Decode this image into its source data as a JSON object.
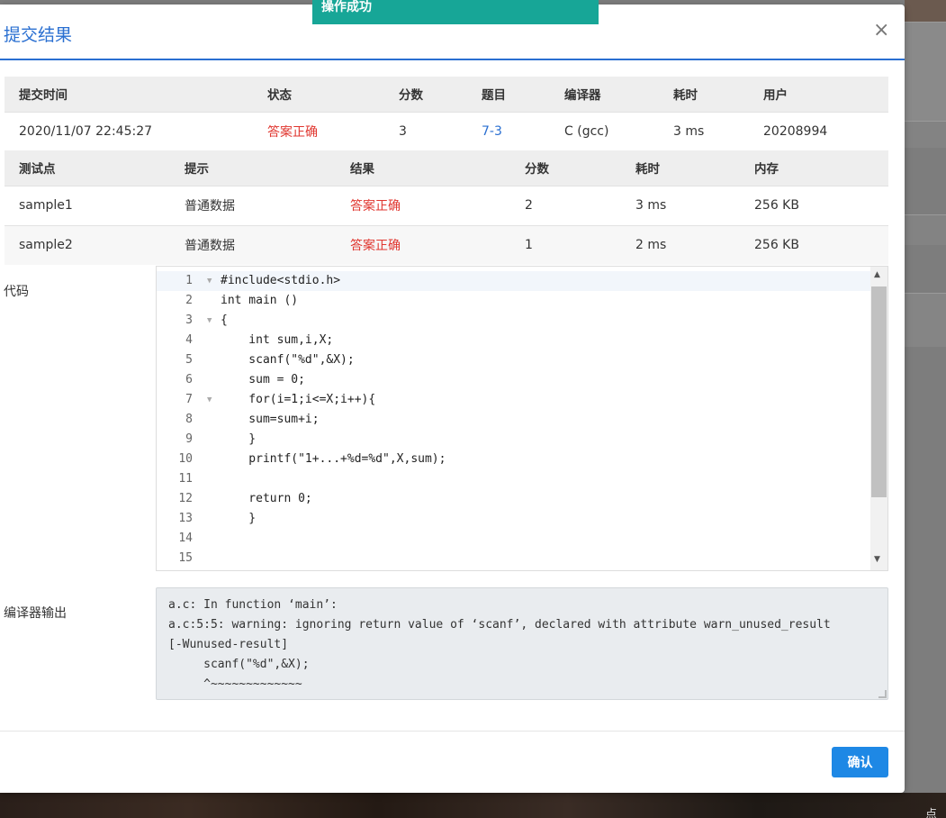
{
  "toast": {
    "text": "操作成功"
  },
  "modal": {
    "title": "提交结果",
    "close_glyph": "×"
  },
  "submission_table": {
    "headers": [
      "提交时间",
      "状态",
      "分数",
      "题目",
      "编译器",
      "耗时",
      "用户"
    ],
    "row": {
      "time": "2020/11/07 22:45:27",
      "status": "答案正确",
      "score": "3",
      "problem": "7-3",
      "compiler": "C (gcc)",
      "elapsed": "3 ms",
      "user": "20208994"
    }
  },
  "testcase_table": {
    "headers": [
      "测试点",
      "提示",
      "结果",
      "分数",
      "耗时",
      "内存"
    ],
    "rows": [
      {
        "case": "sample1",
        "hint": "普通数据",
        "result": "答案正确",
        "score": "2",
        "elapsed": "3 ms",
        "memory": "256 KB"
      },
      {
        "case": "sample2",
        "hint": "普通数据",
        "result": "答案正确",
        "score": "1",
        "elapsed": "2 ms",
        "memory": "256 KB"
      }
    ]
  },
  "code_section": {
    "label": "代码",
    "lines": [
      {
        "num": "1",
        "text": "#include<stdio.h>"
      },
      {
        "num": "2",
        "text": "int main ()"
      },
      {
        "num": "3",
        "text": "{"
      },
      {
        "num": "4",
        "text": "    int sum,i,X;"
      },
      {
        "num": "5",
        "text": "    scanf(\"%d\",&X);"
      },
      {
        "num": "6",
        "text": "    sum = 0;"
      },
      {
        "num": "7",
        "text": "    for(i=1;i<=X;i++){"
      },
      {
        "num": "8",
        "text": "    sum=sum+i;"
      },
      {
        "num": "9",
        "text": "    }"
      },
      {
        "num": "10",
        "text": "    printf(\"1+...+%d=%d\",X,sum);"
      },
      {
        "num": "11",
        "text": "    "
      },
      {
        "num": "12",
        "text": "    return 0;"
      },
      {
        "num": "13",
        "text": "    }"
      },
      {
        "num": "14",
        "text": ""
      },
      {
        "num": "15",
        "text": ""
      }
    ]
  },
  "compiler_output": {
    "label": "编译器输出",
    "text": "a.c: In function ‘main’:\na.c:5:5: warning: ignoring return value of ‘scanf’, declared with attribute warn_unused_result\n[-Wunused-result]\n     scanf(\"%d\",&X);\n     ^~~~~~~~~~~~~~"
  },
  "footer": {
    "confirm_label": "确认"
  },
  "background": {
    "corner_text": "点击"
  },
  "colors": {
    "accent": "#2a6fd1",
    "status_ok": "#e0362f",
    "toast": "#17a697",
    "button": "#1e88e5"
  }
}
